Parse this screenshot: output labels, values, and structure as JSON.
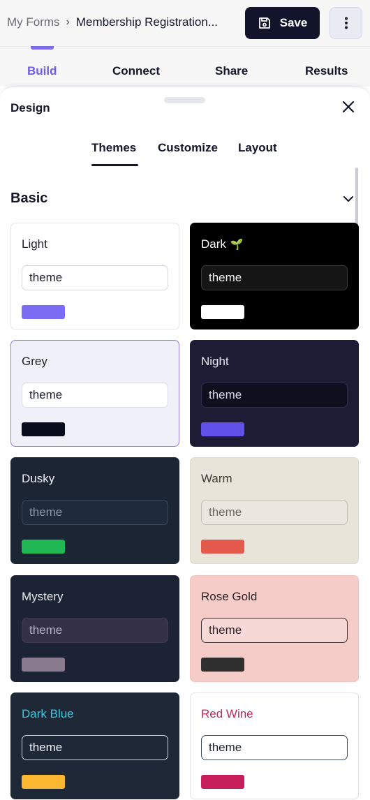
{
  "breadcrumb": {
    "root": "My Forms",
    "separator": "›",
    "current": "Membership Registration..."
  },
  "toolbar": {
    "save_label": "Save"
  },
  "main_tabs": [
    {
      "label": "Build",
      "active": true
    },
    {
      "label": "Connect",
      "active": false
    },
    {
      "label": "Share",
      "active": false
    },
    {
      "label": "Results",
      "active": false
    }
  ],
  "panel": {
    "title": "Design",
    "tabs": [
      {
        "label": "Themes",
        "active": true
      },
      {
        "label": "Customize",
        "active": false
      },
      {
        "label": "Layout",
        "active": false
      }
    ],
    "section": "Basic"
  },
  "themes": [
    {
      "name": "Light",
      "input_text": "theme",
      "colors": {
        "bg": "#ffffff",
        "border": "#e3e4ea",
        "name": "#1d1f2b",
        "input_bg": "#ffffff",
        "input_border": "#d5d7df",
        "input_text": "#1d1f2b",
        "swatch": "#7b6cf2"
      }
    },
    {
      "name": "Dark",
      "emoji": "🌱",
      "input_text": "theme",
      "colors": {
        "bg": "#000000",
        "border": "#000000",
        "name": "#ffffff",
        "input_bg": "#151515",
        "input_border": "#3a3a3a",
        "input_text": "#f1f1f1",
        "swatch": "#ffffff"
      }
    },
    {
      "name": "Grey",
      "input_text": "theme",
      "colors": {
        "bg": "#f0f0f8",
        "border": "#8a80e6",
        "name": "#1d1f2b",
        "input_bg": "#ffffff",
        "input_border": "#dcdde6",
        "input_text": "#1d1f2b",
        "swatch": "#070b1c"
      }
    },
    {
      "name": "Night",
      "input_text": "theme",
      "colors": {
        "bg": "#1c1d35",
        "border": "#1c1d35",
        "name": "#e6e7f2",
        "input_bg": "#0e0f1f",
        "input_border": "#2b2c47",
        "input_text": "#d7d8e6",
        "swatch": "#6251e8"
      }
    },
    {
      "name": "Dusky",
      "input_text": "theme",
      "colors": {
        "bg": "#1b2533",
        "border": "#1b2533",
        "name": "#f1f3f7",
        "input_bg": "#1f2b3a",
        "input_border": "#3a4a5c",
        "input_text": "#8c98a8",
        "swatch": "#1eb955"
      }
    },
    {
      "name": "Warm",
      "input_text": "theme",
      "colors": {
        "bg": "#e8e4da",
        "border": "#dedad0",
        "name": "#3e3b36",
        "input_bg": "#ebe7de",
        "input_border": "#c3bfb5",
        "input_text": "#6b6760",
        "swatch": "#e45a4d"
      }
    },
    {
      "name": "Mystery",
      "input_text": "theme",
      "colors": {
        "bg": "#1c2334",
        "border": "#1c2334",
        "name": "#e7e9f0",
        "input_bg": "#353248",
        "input_border": "#3d3a52",
        "input_text": "#b6b3c6",
        "swatch": "#8a7b8f"
      }
    },
    {
      "name": "Rose Gold",
      "input_text": "theme",
      "colors": {
        "bg": "#f6ccc8",
        "border": "#f0c3be",
        "name": "#2c2425",
        "input_bg": "#f6d9d6",
        "input_border": "#3a2f30",
        "input_text": "#2c2425",
        "swatch": "#2f2f2f"
      }
    },
    {
      "name": "Dark Blue",
      "input_text": "theme",
      "colors": {
        "bg": "#1e2836",
        "border": "#1e2836",
        "name": "#3ec6dc",
        "input_bg": "#1e2836",
        "input_border": "#cfd6df",
        "input_text": "#f2f4f7",
        "swatch": "#fbb72f"
      }
    },
    {
      "name": "Red Wine",
      "input_text": "theme",
      "colors": {
        "bg": "#ffffff",
        "border": "#e3e4ea",
        "name": "#c3245a",
        "input_bg": "#ffffff",
        "input_border": "#3a4a5a",
        "input_text": "#1d2533",
        "swatch": "#c81e5a"
      }
    }
  ],
  "icons": {
    "save": "floppy-disk-icon",
    "more": "kebab-menu-icon",
    "close": "close-icon",
    "collapse": "chevron-down-icon"
  }
}
